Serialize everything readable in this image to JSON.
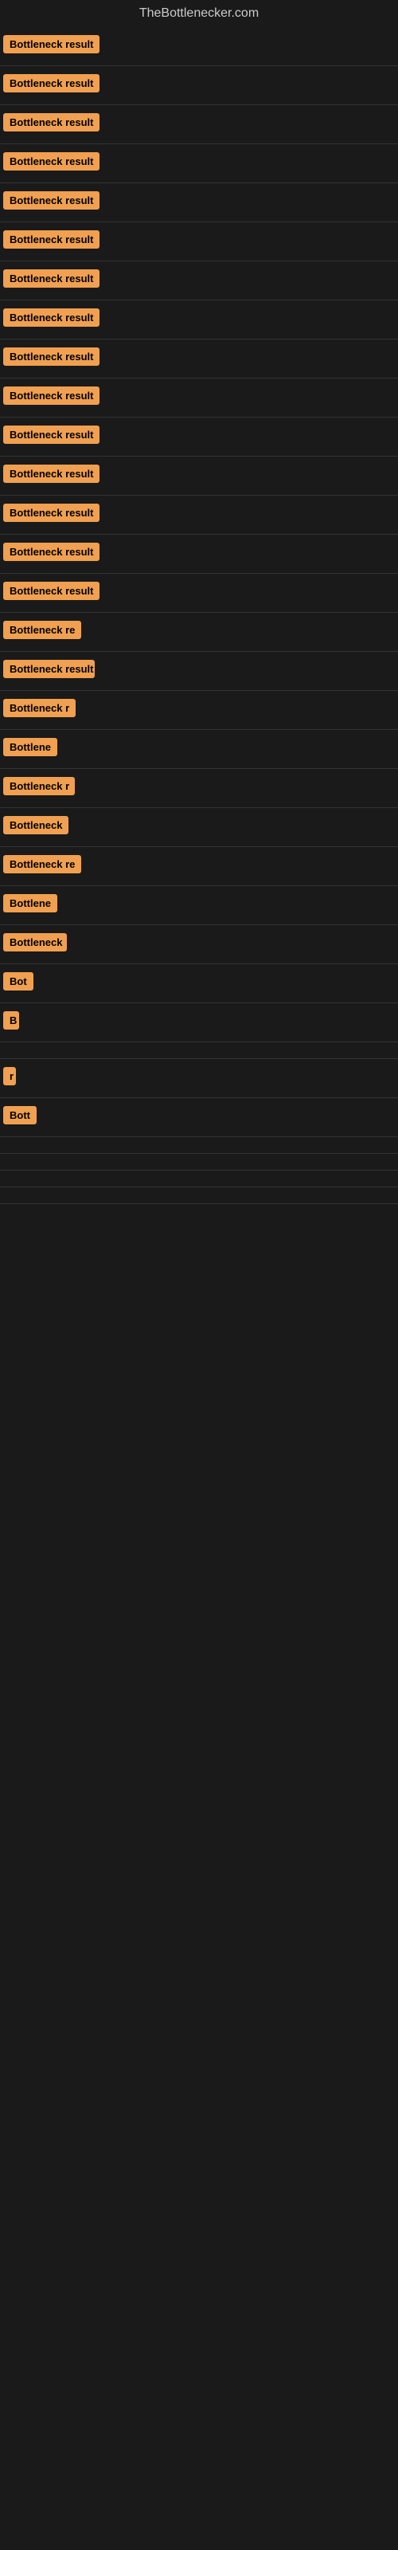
{
  "site": {
    "title": "TheBottlenecker.com"
  },
  "results": [
    {
      "id": 1,
      "label": "Bottleneck result",
      "width": 145
    },
    {
      "id": 2,
      "label": "Bottleneck result",
      "width": 145
    },
    {
      "id": 3,
      "label": "Bottleneck result",
      "width": 145
    },
    {
      "id": 4,
      "label": "Bottleneck result",
      "width": 145
    },
    {
      "id": 5,
      "label": "Bottleneck result",
      "width": 145
    },
    {
      "id": 6,
      "label": "Bottleneck result",
      "width": 145
    },
    {
      "id": 7,
      "label": "Bottleneck result",
      "width": 145
    },
    {
      "id": 8,
      "label": "Bottleneck result",
      "width": 145
    },
    {
      "id": 9,
      "label": "Bottleneck result",
      "width": 145
    },
    {
      "id": 10,
      "label": "Bottleneck result",
      "width": 145
    },
    {
      "id": 11,
      "label": "Bottleneck result",
      "width": 145
    },
    {
      "id": 12,
      "label": "Bottleneck result",
      "width": 130
    },
    {
      "id": 13,
      "label": "Bottleneck result",
      "width": 130
    },
    {
      "id": 14,
      "label": "Bottleneck result",
      "width": 130
    },
    {
      "id": 15,
      "label": "Bottleneck result",
      "width": 130
    },
    {
      "id": 16,
      "label": "Bottleneck re",
      "width": 110
    },
    {
      "id": 17,
      "label": "Bottleneck result",
      "width": 115
    },
    {
      "id": 18,
      "label": "Bottleneck r",
      "width": 95
    },
    {
      "id": 19,
      "label": "Bottlene",
      "width": 75
    },
    {
      "id": 20,
      "label": "Bottleneck r",
      "width": 90
    },
    {
      "id": 21,
      "label": "Bottleneck",
      "width": 85
    },
    {
      "id": 22,
      "label": "Bottleneck re",
      "width": 100
    },
    {
      "id": 23,
      "label": "Bottlene",
      "width": 70
    },
    {
      "id": 24,
      "label": "Bottleneck",
      "width": 80
    },
    {
      "id": 25,
      "label": "Bot",
      "width": 40
    },
    {
      "id": 26,
      "label": "B",
      "width": 20
    },
    {
      "id": 27,
      "label": "",
      "width": 0
    },
    {
      "id": 28,
      "label": "r",
      "width": 12
    },
    {
      "id": 29,
      "label": "Bott",
      "width": 42
    },
    {
      "id": 30,
      "label": "",
      "width": 0
    },
    {
      "id": 31,
      "label": "",
      "width": 0
    },
    {
      "id": 32,
      "label": "",
      "width": 0
    },
    {
      "id": 33,
      "label": "",
      "width": 0
    }
  ]
}
